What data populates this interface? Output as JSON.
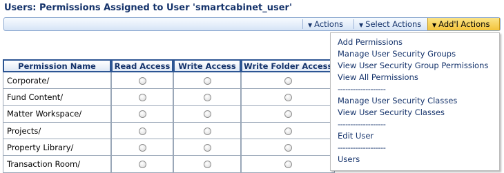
{
  "page": {
    "title": "Users: Permissions Assigned to User 'smartcabinet_user'"
  },
  "action_bar": {
    "actions_label": "Actions",
    "select_actions_label": "Select Actions",
    "addl_actions_label": "Add'l Actions"
  },
  "table": {
    "headers": [
      "Permission Name",
      "Read Access",
      "Write Access",
      "Write Folder Access"
    ],
    "rows": [
      "Corporate/",
      "Fund Content/",
      "Matter Workspace/",
      "Projects/",
      "Property Library/",
      "Transaction Room/"
    ]
  },
  "dropdown": {
    "items": [
      "Add Permissions",
      "Manage User Security Groups",
      "View User Security Group Permissions",
      "View All Permissions",
      "-------------------",
      "Manage User Security Classes",
      "View User Security Classes",
      "-------------------",
      "Edit User",
      "-------------------",
      "Users"
    ]
  }
}
